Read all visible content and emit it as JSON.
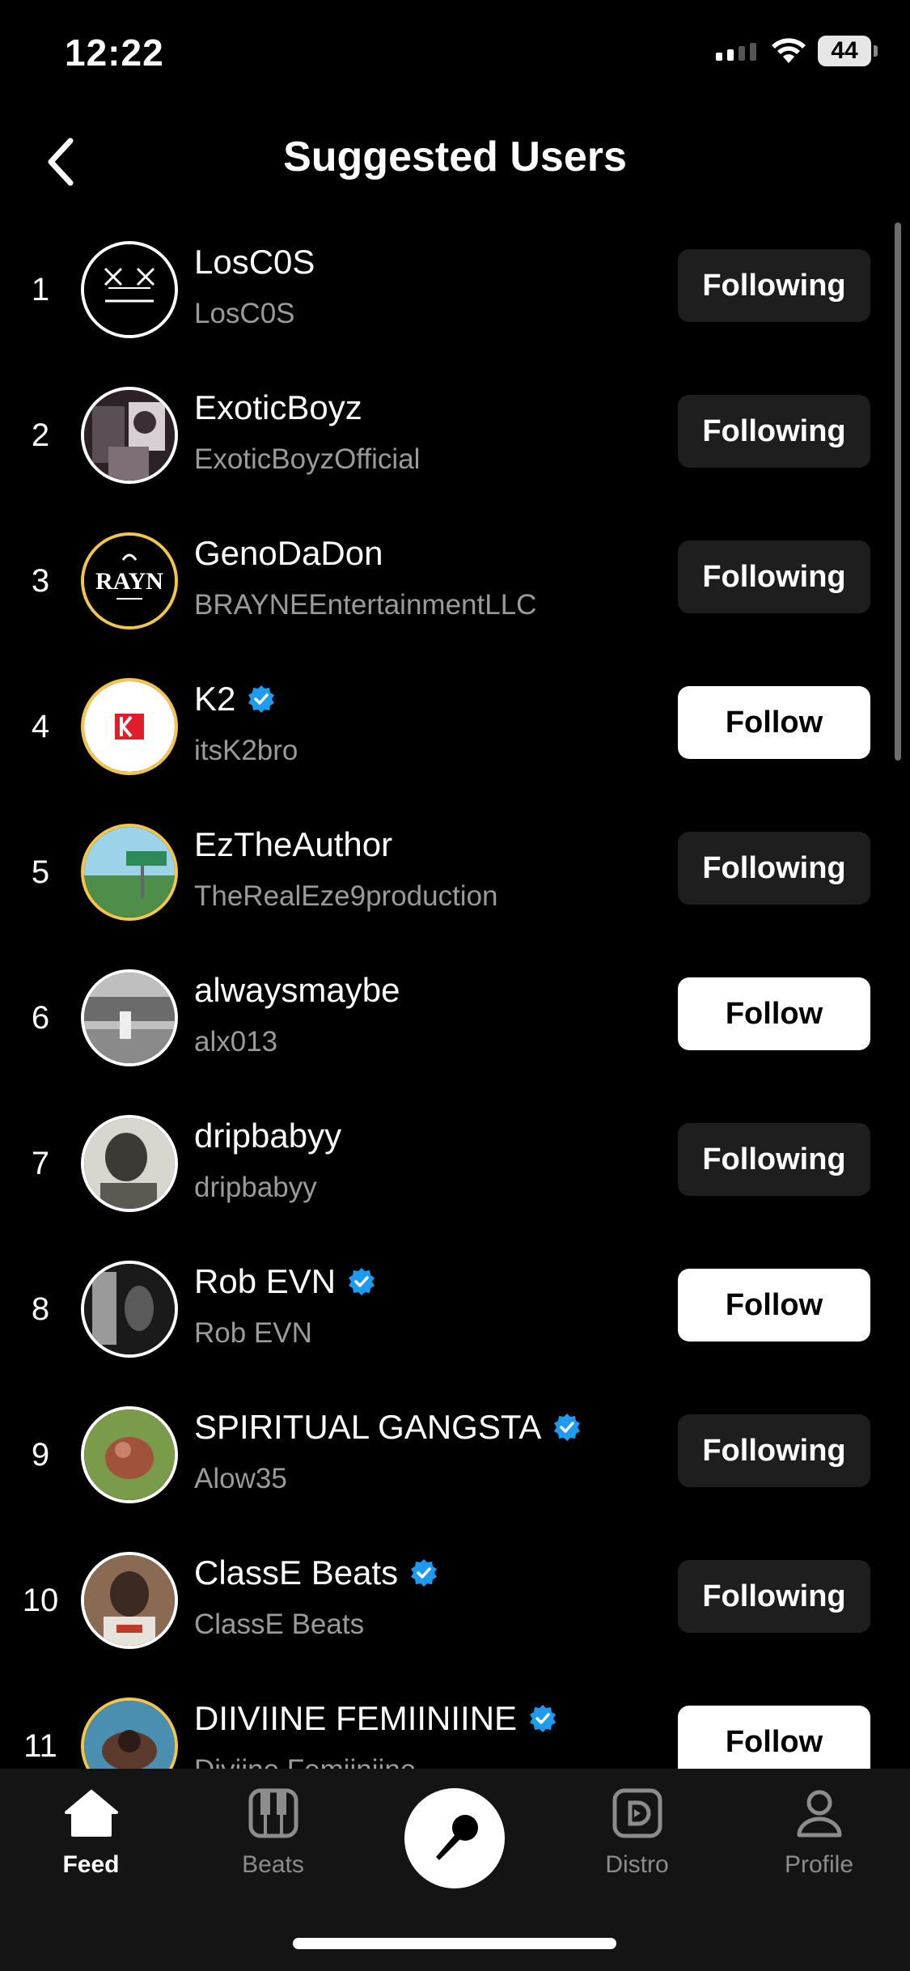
{
  "status": {
    "time": "12:22",
    "battery": "44"
  },
  "header": {
    "title": "Suggested Users"
  },
  "users": [
    {
      "rank": "1",
      "name": "LosC0S",
      "handle": "LosC0S",
      "verified": false,
      "button": "Following",
      "state": "following"
    },
    {
      "rank": "2",
      "name": "ExoticBoyz",
      "handle": "ExoticBoyzOfficial",
      "verified": false,
      "button": "Following",
      "state": "following"
    },
    {
      "rank": "3",
      "name": "GenoDaDon",
      "handle": "BRAYNEEntertainmentLLC",
      "verified": false,
      "button": "Following",
      "state": "following"
    },
    {
      "rank": "4",
      "name": "K2",
      "handle": "itsK2bro",
      "verified": true,
      "button": "Follow",
      "state": "follow"
    },
    {
      "rank": "5",
      "name": "EzTheAuthor",
      "handle": "TheRealEze9production",
      "verified": false,
      "button": "Following",
      "state": "following"
    },
    {
      "rank": "6",
      "name": "alwaysmaybe",
      "handle": "alx013",
      "verified": false,
      "button": "Follow",
      "state": "follow"
    },
    {
      "rank": "7",
      "name": "dripbabyy",
      "handle": "dripbabyy",
      "verified": false,
      "button": "Following",
      "state": "following"
    },
    {
      "rank": "8",
      "name": "Rob EVN",
      "handle": "Rob EVN",
      "verified": true,
      "button": "Follow",
      "state": "follow"
    },
    {
      "rank": "9",
      "name": "SPIRITUAL GANGSTA",
      "handle": "Alow35",
      "verified": true,
      "button": "Following",
      "state": "following"
    },
    {
      "rank": "10",
      "name": "ClassE Beats",
      "handle": "ClassE Beats",
      "verified": true,
      "button": "Following",
      "state": "following"
    },
    {
      "rank": "11",
      "name": "DIIVIINE FEMIINIINE",
      "handle": "Diviine Femiiniine",
      "verified": true,
      "button": "Follow",
      "state": "follow"
    }
  ],
  "tabs": [
    {
      "label": "Feed",
      "icon": "home-icon",
      "active": true
    },
    {
      "label": "Beats",
      "icon": "piano-keys-icon",
      "active": false
    },
    {
      "label": "",
      "icon": "microphone-icon",
      "active": false
    },
    {
      "label": "Distro",
      "icon": "distro-icon",
      "active": false
    },
    {
      "label": "Profile",
      "icon": "person-icon",
      "active": false
    }
  ],
  "colors": {
    "accent_gold": "#f3c64a",
    "verified_blue": "#1d9bf0",
    "button_dark": "#1e1e1e"
  }
}
